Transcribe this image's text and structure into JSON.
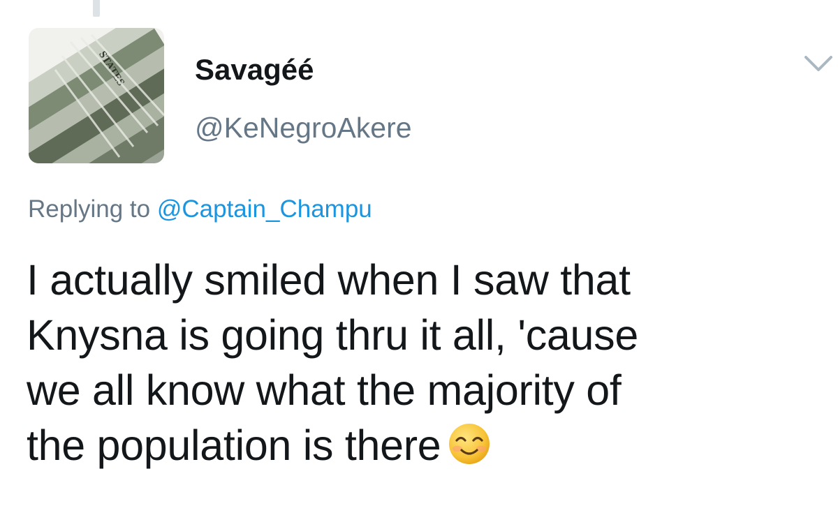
{
  "tweet": {
    "author": {
      "display_name": "Savagéé",
      "handle": "@KeNegroAkere",
      "avatar": "money-banknotes-avatar"
    },
    "menu_icon": "chevron-down-icon",
    "reply_context": {
      "prefix": "Replying to",
      "mention": "@Captain_Champu"
    },
    "text_lines": [
      "I actually smiled when I saw that",
      "Knysna is going thru it all, 'cause",
      "we all know what the majority of",
      "the population is there"
    ],
    "emoji": "smiling-face-emoji",
    "colors": {
      "text": "#14171a",
      "secondary": "#657786",
      "link": "#1b95e0",
      "thread_line": "#dde2e6"
    }
  }
}
